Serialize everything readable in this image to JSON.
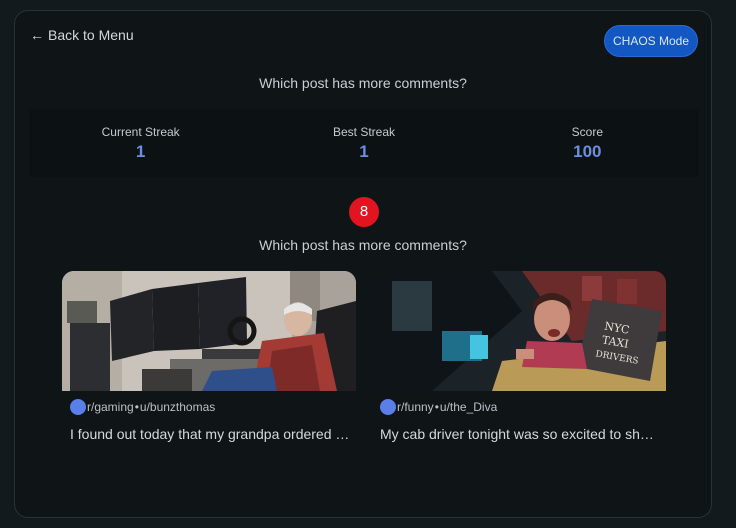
{
  "nav": {
    "back_label": "Back to Menu",
    "back_icon": "arrow-left-icon"
  },
  "mode_button": {
    "label": "CHAOS Mode",
    "color": "#1357c2"
  },
  "question": "Which post has more comments?",
  "stats": [
    {
      "label": "Current Streak",
      "value": "1"
    },
    {
      "label": "Best Streak",
      "value": "1"
    },
    {
      "label": "Score",
      "value": "100"
    }
  ],
  "timer": {
    "value": "8",
    "color": "#e1141f"
  },
  "posts": [
    {
      "subreddit": "r/gaming",
      "separator": "•",
      "user": "u/bunzthomas",
      "title": "I found out today that my grandpa ordered a racing wheel setup",
      "image": "photo of an elderly man sitting at a multi-monitor racing simulator desk"
    },
    {
      "subreddit": "r/funny",
      "separator": "•",
      "user": "u/the_Diva",
      "title": "My cab driver tonight was so excited to show me his sign",
      "image": "photo inside a taxi cab with a child holding a NYC Taxi Drivers sign"
    }
  ],
  "colors": {
    "accent": "#6b8fe0",
    "avatar": "#5b7fe8",
    "background": "#0f1417"
  }
}
